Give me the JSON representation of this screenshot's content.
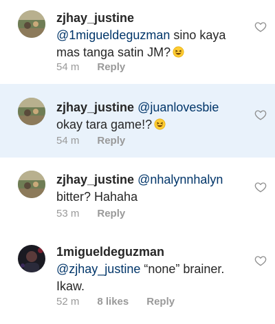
{
  "comments": [
    {
      "username": "zjhay_justine",
      "mention": "@1migueldeguzman",
      "text_line1_rest": "sino kaya",
      "text_line2": "mas tanga satin JM?",
      "time": "54 m",
      "reply": "Reply",
      "avatar": "avatar-zjhay"
    },
    {
      "username": "zjhay_justine",
      "mention": "@juanlovesbie",
      "text_line2": "okay tara game!?",
      "time": "54 m",
      "reply": "Reply",
      "avatar": "avatar-zjhay"
    },
    {
      "username": "zjhay_justine",
      "mention": "@nhalynnhalyn",
      "text_line2": "bitter? Hahaha",
      "time": "53 m",
      "reply": "Reply",
      "avatar": "avatar-zjhay"
    },
    {
      "username": "1migueldeguzman",
      "mention": "@zjhay_justine",
      "text_line2_rest": "“none” brainer.",
      "text_line3": "Ikaw.",
      "time": "52 m",
      "likes": "8 likes",
      "reply": "Reply",
      "avatar": "avatar-miguel"
    }
  ],
  "icons": {
    "like": "heart-outline-icon",
    "emoji": "grinning-squinting-face-emoji"
  },
  "colors": {
    "highlight_bg": "#e9f2fb",
    "mention": "#003569",
    "meta": "#999999",
    "text": "#262626"
  }
}
